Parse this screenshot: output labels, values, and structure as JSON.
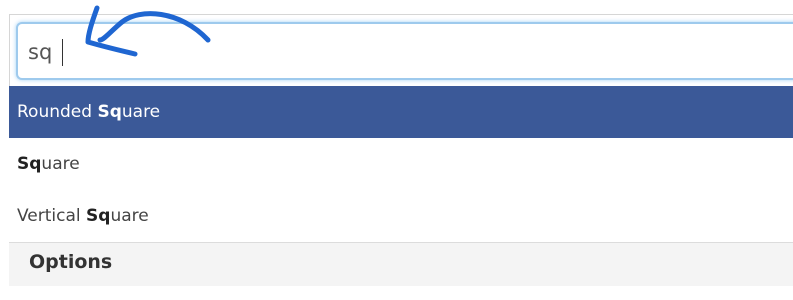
{
  "search": {
    "value": "sq"
  },
  "results": [
    {
      "prefix": "Rounded ",
      "match": "Sq",
      "suffix": "uare",
      "active": true
    },
    {
      "prefix": "",
      "match": "Sq",
      "suffix": "uare",
      "active": false
    },
    {
      "prefix": "Vertical ",
      "match": "Sq",
      "suffix": "uare",
      "active": false
    }
  ],
  "options": {
    "title": "Options"
  },
  "colors": {
    "highlight": "#3b5998",
    "input_focus_border": "#9ecaed",
    "annotation_arrow": "#1f66d1"
  },
  "icons": {
    "annotation": "curved-arrow-icon"
  }
}
